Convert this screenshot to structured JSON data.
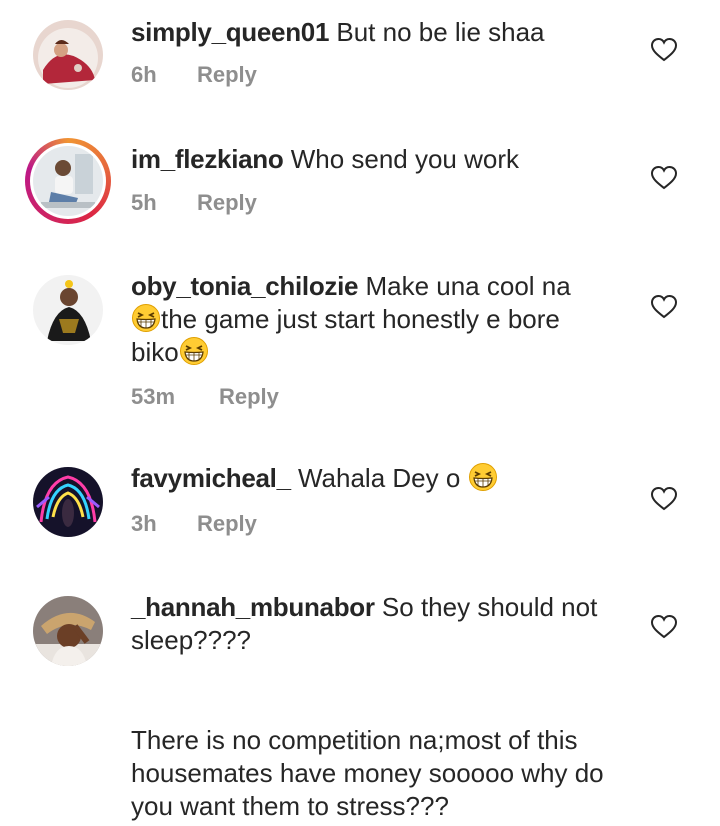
{
  "comments": [
    {
      "username": "simply_queen01",
      "text": "But no be lie shaa",
      "time": "6h",
      "reply": "Reply"
    },
    {
      "username": "im_flezkiano",
      "text": "Who send you work",
      "time": "5h",
      "reply": "Reply"
    },
    {
      "username": "oby_tonia_chilozie",
      "text_1": "Make una cool na",
      "text_2": "the game just start honestly e bore",
      "text_3": "biko",
      "time": "53m",
      "reply": "Reply"
    },
    {
      "username": "favymicheal_",
      "text": "Wahala Dey o",
      "time": "3h",
      "reply": "Reply"
    },
    {
      "username": "_hannah_mbunabor",
      "text": "So they should not sleep????"
    }
  ],
  "standalone_text": "There is no competition na;most of this housemates have money sooooo why do you want them to stress???",
  "icons": {
    "like": "heart-outline-icon",
    "emoji": "grinning-squinting-face-emoji"
  }
}
